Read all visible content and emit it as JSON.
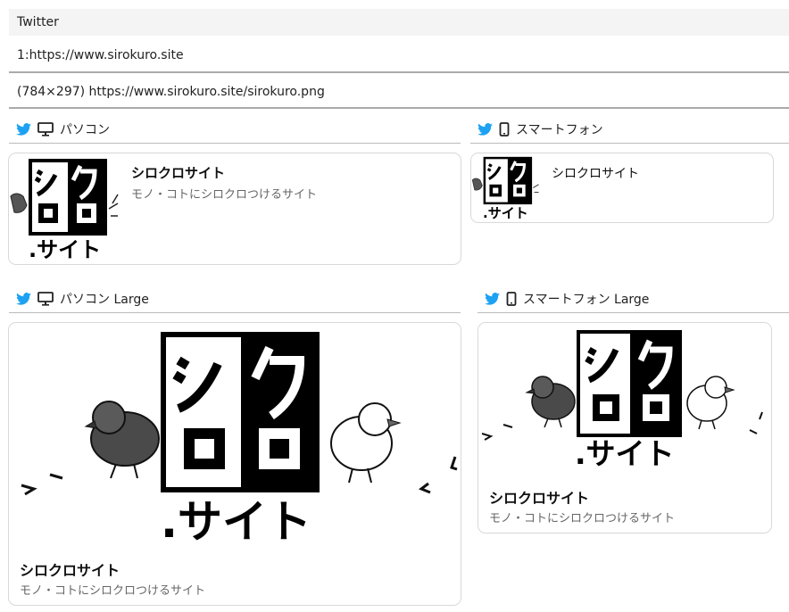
{
  "header": {
    "title": "Twitter"
  },
  "meta": {
    "url_line": "1:https://www.sirokuro.site",
    "image_line": "(784×297) https://www.sirokuro.site/sirokuro.png"
  },
  "sections": {
    "pc": "パソコン",
    "sp": "スマートフォン",
    "pc_large": "パソコン Large",
    "sp_large": "スマートフォン Large"
  },
  "card": {
    "title": "シロクロサイト",
    "description": "モノ・コトにシロクロつけるサイト",
    "logo_text": ".サイト"
  },
  "icons": {
    "twitter": "twitter-bird-icon",
    "pc": "desktop-monitor-icon",
    "sp": "smartphone-icon"
  },
  "colors": {
    "twitter": "#1da1f2"
  }
}
